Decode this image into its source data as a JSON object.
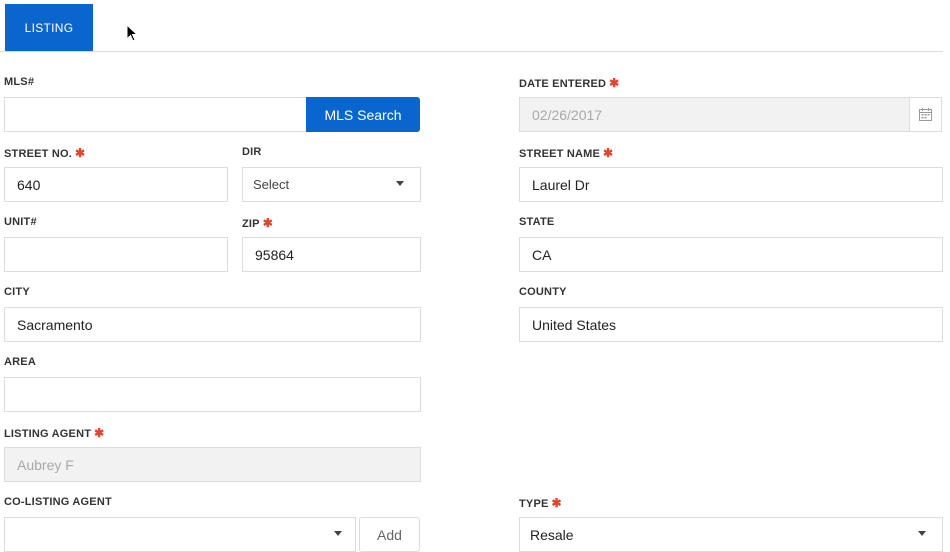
{
  "tabs": [
    {
      "label": "LISTING"
    }
  ],
  "form": {
    "mls": {
      "label": "MLS#",
      "value": "",
      "search_button": "MLS Search"
    },
    "date_entered": {
      "label": "DATE ENTERED",
      "value": "02/26/2017",
      "icon": "calendar-icon"
    },
    "street_no": {
      "label": "STREET NO.",
      "value": "640"
    },
    "dir": {
      "label": "DIR",
      "value": "Select"
    },
    "street_name": {
      "label": "STREET NAME",
      "value": "Laurel Dr"
    },
    "unit": {
      "label": "UNIT#",
      "value": ""
    },
    "zip": {
      "label": "ZIP",
      "value": "95864"
    },
    "state": {
      "label": "STATE",
      "value": "CA"
    },
    "city": {
      "label": "CITY",
      "value": "Sacramento"
    },
    "county": {
      "label": "COUNTY",
      "value": "United States"
    },
    "area": {
      "label": "AREA",
      "value": ""
    },
    "listing_agent": {
      "label": "LISTING AGENT",
      "value": "Aubrey F"
    },
    "co_listing_agent": {
      "label": "CO-LISTING AGENT",
      "value": "",
      "add_button": "Add"
    },
    "type": {
      "label": "TYPE",
      "value": "Resale"
    }
  },
  "colors": {
    "accent": "#0a66cc",
    "required": "#e2452d"
  },
  "required_marker": "✱"
}
